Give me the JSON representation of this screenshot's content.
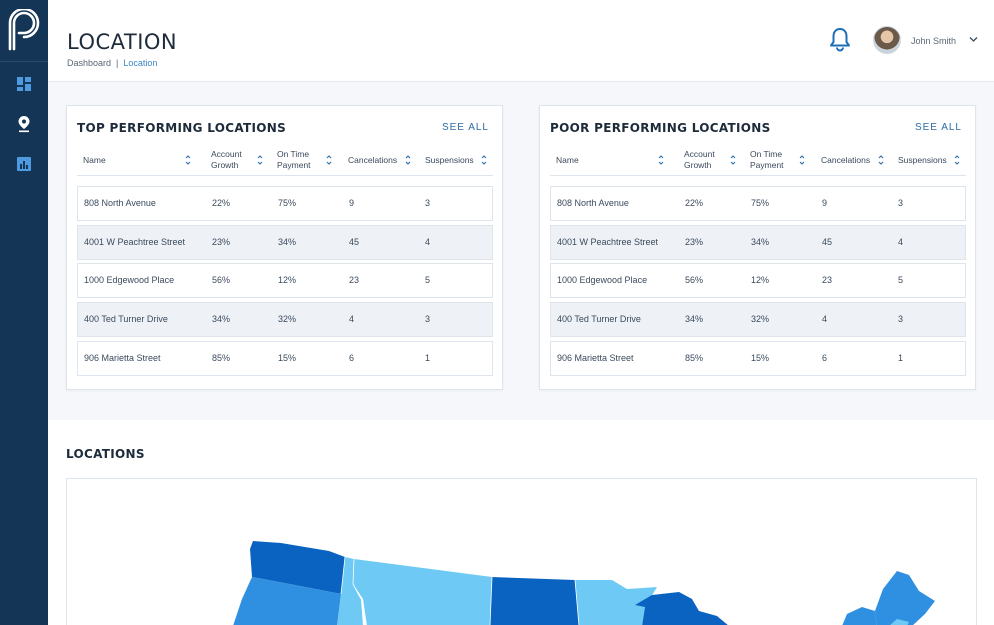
{
  "header": {
    "title": "LOCATION",
    "breadcrumb": {
      "root": "Dashboard",
      "separator": "|",
      "current": "Location"
    },
    "user": {
      "name": "John Smith"
    }
  },
  "sidebar": {
    "items": [
      {
        "icon": "dashboard-icon"
      },
      {
        "icon": "location-pin-icon"
      },
      {
        "icon": "bar-chart-icon"
      }
    ]
  },
  "columns": {
    "name": "Name",
    "growth_1": "Account",
    "growth_2": "Growth",
    "payment_1": "On Time",
    "payment_2": "Payment",
    "cancelations": "Cancelations",
    "suspensions": "Suspensions"
  },
  "top_card": {
    "title": "TOP PERFORMING LOCATIONS",
    "see_all": "SEE ALL",
    "rows": [
      {
        "name": "808 North Avenue",
        "growth": "22%",
        "payment": "75%",
        "cancelations": "9",
        "suspensions": "3"
      },
      {
        "name": "4001 W Peachtree Street",
        "growth": "23%",
        "payment": "34%",
        "cancelations": "45",
        "suspensions": "4"
      },
      {
        "name": "1000 Edgewood Place",
        "growth": "56%",
        "payment": "12%",
        "cancelations": "23",
        "suspensions": "5"
      },
      {
        "name": "400 Ted Turner Drive",
        "growth": "34%",
        "payment": "32%",
        "cancelations": "4",
        "suspensions": "3"
      },
      {
        "name": "906 Marietta Street",
        "growth": "85%",
        "payment": "15%",
        "cancelations": "6",
        "suspensions": "1"
      }
    ]
  },
  "poor_card": {
    "title": "POOR PERFORMING LOCATIONS",
    "see_all": "SEE ALL",
    "rows": [
      {
        "name": "808 North Avenue",
        "growth": "22%",
        "payment": "75%",
        "cancelations": "9",
        "suspensions": "3"
      },
      {
        "name": "4001 W Peachtree Street",
        "growth": "23%",
        "payment": "34%",
        "cancelations": "45",
        "suspensions": "4"
      },
      {
        "name": "1000 Edgewood Place",
        "growth": "56%",
        "payment": "12%",
        "cancelations": "23",
        "suspensions": "5"
      },
      {
        "name": "400 Ted Turner Drive",
        "growth": "34%",
        "payment": "32%",
        "cancelations": "4",
        "suspensions": "3"
      },
      {
        "name": "906 Marietta Street",
        "growth": "85%",
        "payment": "15%",
        "cancelations": "6",
        "suspensions": "1"
      }
    ]
  },
  "locations": {
    "title": "LOCATIONS"
  },
  "colors": {
    "sidebar": "#153556",
    "accent": "#3d86c6",
    "row_alt": "#eef1f6",
    "map_dark": "#0a63c0",
    "map_mid": "#2f8fe0",
    "map_light": "#6ecaf5"
  }
}
